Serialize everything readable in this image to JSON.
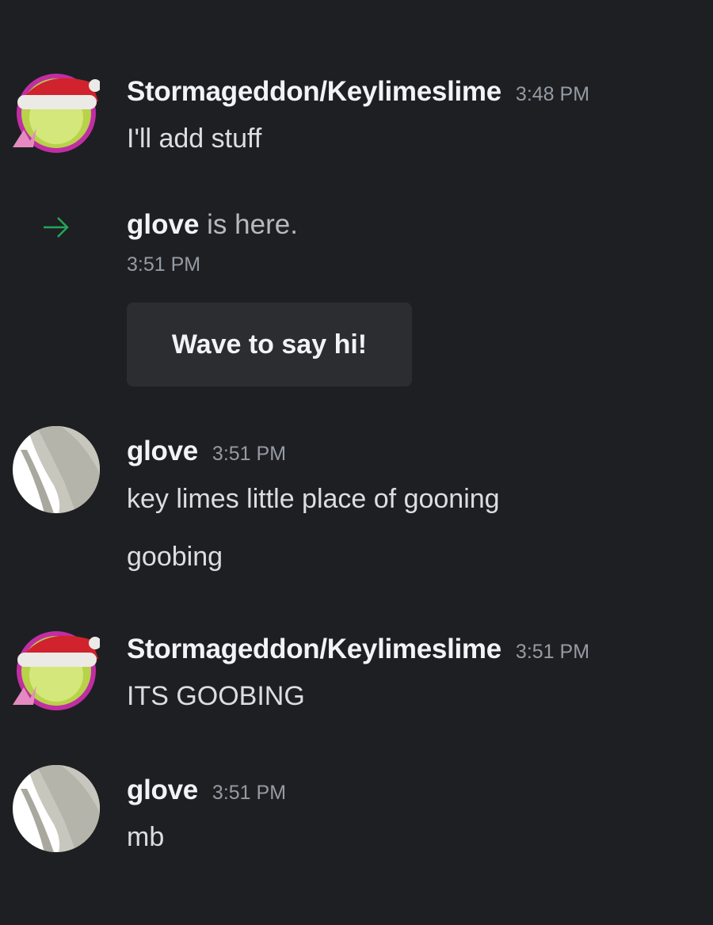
{
  "messages": [
    {
      "username": "Stormageddon/Keylimeslime",
      "timestamp": "3:48 PM",
      "lines": [
        "I'll add stuff"
      ]
    },
    {
      "username": "glove",
      "timestamp": "3:51 PM",
      "lines": [
        "key limes little place of gooning",
        "goobing"
      ]
    },
    {
      "username": "Stormageddon/Keylimeslime",
      "timestamp": "3:51 PM",
      "lines": [
        "ITS GOOBING"
      ]
    },
    {
      "username": "glove",
      "timestamp": "3:51 PM",
      "lines": [
        "mb"
      ]
    }
  ],
  "join_event": {
    "username": "glove",
    "text": " is here.",
    "timestamp": "3:51 PM",
    "wave_button_label": "Wave to say hi!",
    "arrow_icon": "arrow-right-icon",
    "arrow_color": "#23a55a"
  },
  "colors": {
    "background": "#1e1f22",
    "username": "#f2f3f5",
    "message_text": "#dbdee1",
    "timestamp": "#949ba4",
    "button_bg": "#2b2d31"
  }
}
